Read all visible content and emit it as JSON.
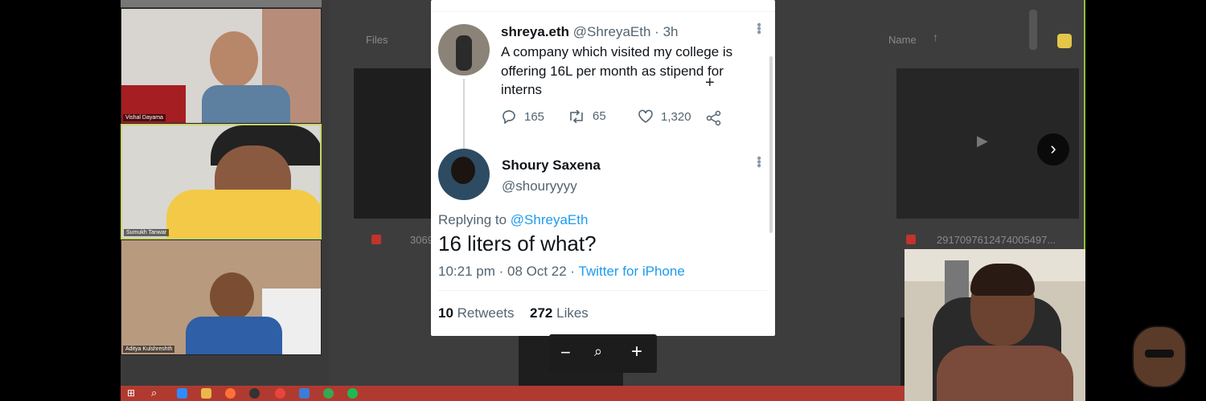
{
  "participants": [
    {
      "name": "Vishal Dayama"
    },
    {
      "name": "Sumukh Tanwar"
    },
    {
      "name": "Aditya Kulshreshth"
    }
  ],
  "background": {
    "files_label": "Files",
    "sort_label": "Name",
    "file_left": "3069",
    "file_right": "2917097612474005497..."
  },
  "tweet": {
    "author_name": "shreya.eth",
    "author_handle": "@ShreyaEth",
    "time": "3h",
    "text": "A company which visited my college is offering 16L per month as stipend for interns",
    "replies": "165",
    "retweets": "65",
    "likes": "1,320",
    "reply_name": "Shoury Saxena",
    "reply_handle": "@shouryyyy",
    "replying_to_label": "Replying to",
    "replying_to_handle": "@ShreyaEth",
    "reply_text": "16 liters of what?",
    "reply_time": "10:21 pm · 08 Oct 22 · ",
    "reply_client": "Twitter for iPhone",
    "retweet_count": "10",
    "retweet_label": "Retweets",
    "like_count": "272",
    "like_label": "Likes"
  },
  "zoom_controls": {
    "minus": "−",
    "plus": "+"
  },
  "colors": {
    "twitter_blue": "#1d9bf0",
    "taskbar": "#b03a30",
    "active_border": "#c9d26a"
  }
}
